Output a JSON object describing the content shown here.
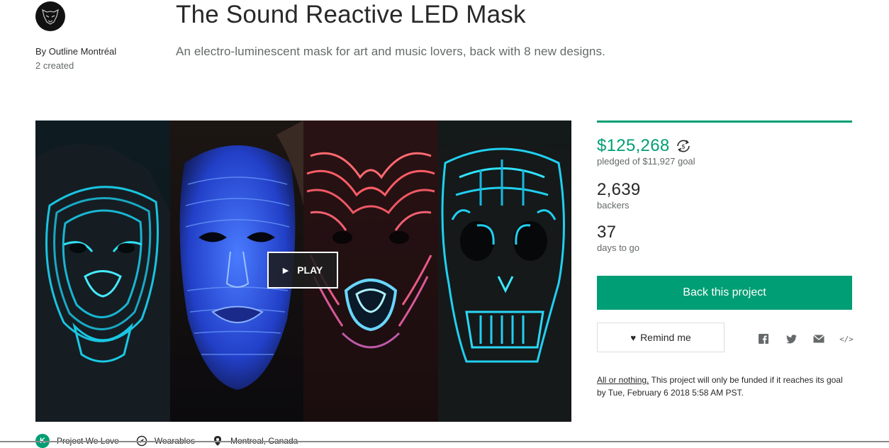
{
  "creator": {
    "by_label": "By Outline Montréal",
    "created_count": "2 created"
  },
  "project": {
    "title": "The Sound Reactive LED Mask",
    "blurb": "An electro-luminescent mask for art and music lovers, back with 8 new designs."
  },
  "video": {
    "play_label": "PLAY"
  },
  "stats": {
    "funded_fraction": 1.0,
    "pledged_amount": "$125,268",
    "pledged_label": "pledged of $11,927 goal",
    "backers_count": "2,639",
    "backers_label": "backers",
    "days_count": "37",
    "days_label": "days to go"
  },
  "actions": {
    "back_label": "Back this project",
    "remind_label": "Remind me"
  },
  "share_icons": [
    "facebook-icon",
    "twitter-icon",
    "email-icon",
    "embed-icon"
  ],
  "funding_note": {
    "link_text": "All or nothing.",
    "text": " This project will only be funded if it reaches its goal by Tue, February 6 2018 5:58 AM PST."
  },
  "footer": {
    "project_we_love": "Project We Love",
    "category": "Wearables",
    "location": "Montreal, Canada"
  },
  "colors": {
    "accent": "#009e74",
    "text": "#282828",
    "muted": "#656969"
  }
}
